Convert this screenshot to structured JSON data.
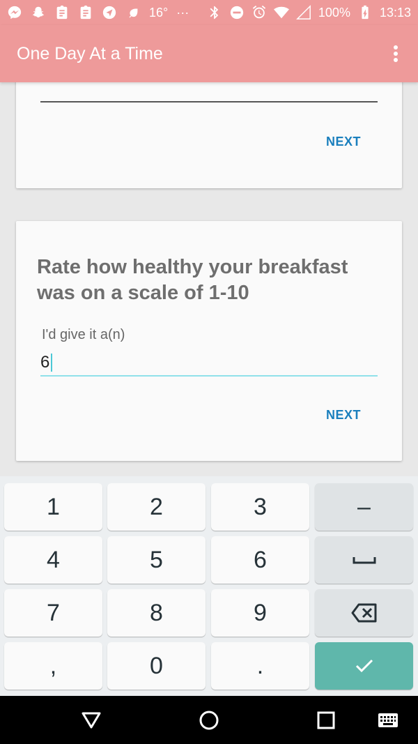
{
  "status_bar": {
    "temperature": "16°",
    "more": "···",
    "battery_percent": "100%",
    "time": "13:13"
  },
  "app_bar": {
    "title": "One Day At a Time"
  },
  "card_1": {
    "next_label": "NEXT"
  },
  "card_2": {
    "question": "Rate how healthy your breakfast was on a scale of 1-10",
    "field_label": "I'd give it a(n)",
    "field_value": "6",
    "next_label": "NEXT"
  },
  "keyboard": {
    "keys": {
      "k1": "1",
      "k2": "2",
      "k3": "3",
      "dash": "–",
      "k4": "4",
      "k5": "5",
      "k6": "6",
      "k7": "7",
      "k8": "8",
      "k9": "9",
      "comma": ",",
      "k0": "0",
      "period": "."
    },
    "icons": {
      "space": "space-icon",
      "backspace": "backspace-icon",
      "done": "check-icon"
    },
    "colors": {
      "done": "#5fb7ab",
      "fn_key": "#dfe3e5"
    }
  },
  "nav_bar": {
    "icons": [
      "back-triangle-icon",
      "home-circle-icon",
      "recents-square-icon",
      "keyboard-icon"
    ]
  },
  "colors": {
    "app_bar": "#ee9a9a",
    "accent": "#1a7fbd",
    "field_underline": "#8fe1ea"
  }
}
